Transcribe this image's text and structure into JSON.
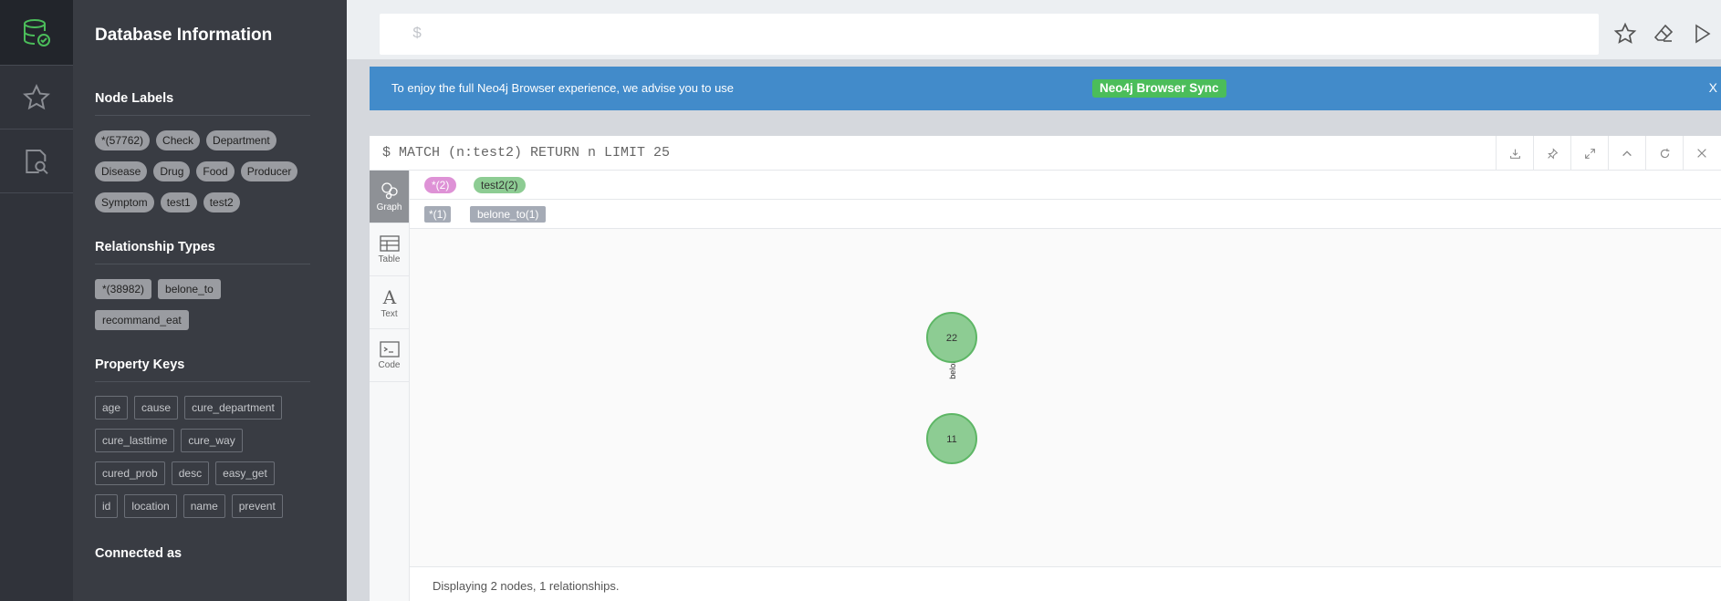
{
  "drawer": {
    "title": "Database Information",
    "node_labels": {
      "heading": "Node Labels",
      "items": [
        "*(57762)",
        "Check",
        "Department",
        "Disease",
        "Drug",
        "Food",
        "Producer",
        "Symptom",
        "test1",
        "test2"
      ]
    },
    "relationship_types": {
      "heading": "Relationship Types",
      "items": [
        "*(38982)",
        "belone_to",
        "recommand_eat"
      ]
    },
    "property_keys": {
      "heading": "Property Keys",
      "items": [
        "age",
        "cause",
        "cure_department",
        "cure_lasttime",
        "cure_way",
        "cured_prob",
        "desc",
        "easy_get",
        "id",
        "location",
        "name",
        "prevent"
      ]
    },
    "connected_heading": "Connected as"
  },
  "rail": {
    "icons": [
      "database-icon",
      "star-icon",
      "search-document-icon"
    ],
    "active_color": "#4bbd5a"
  },
  "editor": {
    "prompt": "$"
  },
  "banner": {
    "text": "To enjoy the full Neo4j Browser experience, we advise you to use",
    "button": "Neo4j Browser Sync",
    "close": "X"
  },
  "frame": {
    "query": "$ MATCH (n:test2) RETURN n LIMIT 25",
    "tabs": [
      {
        "label": "Graph",
        "icon": "graph-icon"
      },
      {
        "label": "Table",
        "icon": "table-icon"
      },
      {
        "label": "Text",
        "icon": "text-icon"
      },
      {
        "label": "Code",
        "icon": "code-icon"
      }
    ],
    "legend_nodes": [
      {
        "label": "*(2)",
        "color": "#de92d6"
      },
      {
        "label": "test2(2)",
        "color": "#8dcc93"
      }
    ],
    "legend_rels": [
      {
        "label": "*(1)"
      },
      {
        "label": "belone_to(1)"
      }
    ],
    "graph": {
      "nodes": [
        "22",
        "11"
      ],
      "relationship": "belone_to",
      "node_color": "#8dcc93",
      "node_border": "#5db665"
    },
    "status": "Displaying 2 nodes, 1 relationships."
  }
}
